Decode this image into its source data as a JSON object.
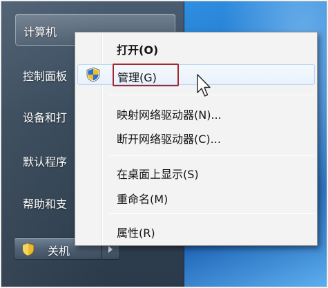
{
  "start_menu": {
    "computer_label": "计算机",
    "items": [
      {
        "label": "控制面板"
      },
      {
        "label": "设备和打"
      },
      {
        "label": "默认程序"
      },
      {
        "label": "帮助和支"
      }
    ],
    "shutdown_label": "关机"
  },
  "context_menu": {
    "items": [
      {
        "label": "打开(O)",
        "bold": true
      },
      {
        "label": "管理(G)",
        "icon": "uac-shield-icon",
        "highlighted": true
      },
      {
        "label": "映射网络驱动器(N)..."
      },
      {
        "label": "断开网络驱动器(C)..."
      },
      {
        "label": "在桌面上显示(S)"
      },
      {
        "label": "重命名(M)"
      },
      {
        "label": "属性(R)"
      }
    ]
  },
  "colors": {
    "highlight_border": "#a3292e",
    "menu_background": "#f3f3f3",
    "hover_border": "#b8d6f5"
  },
  "cursor": {
    "icon": "mouse-pointer-icon"
  }
}
